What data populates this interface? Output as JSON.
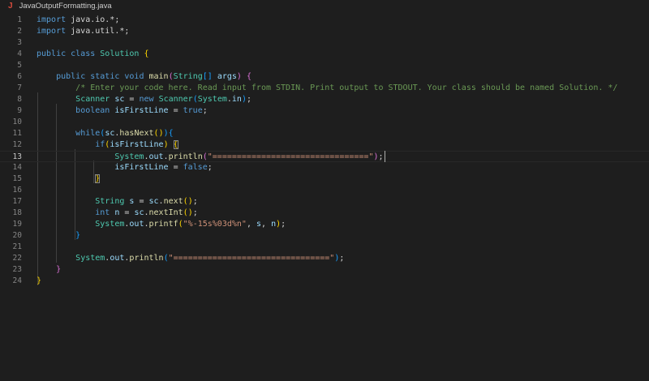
{
  "tab": {
    "icon": "java-file-icon",
    "filename": "JavaOutputFormatting.java"
  },
  "editor": {
    "active_line": 13,
    "lines": [
      {
        "n": "1",
        "tokens": [
          [
            "kw",
            "import"
          ],
          [
            "pl",
            " java.io.*;"
          ]
        ]
      },
      {
        "n": "2",
        "tokens": [
          [
            "kw",
            "import"
          ],
          [
            "pl",
            " java.util.*;"
          ]
        ]
      },
      {
        "n": "3",
        "tokens": []
      },
      {
        "n": "4",
        "tokens": [
          [
            "kw",
            "public class "
          ],
          [
            "ty",
            "Solution"
          ],
          [
            "pl",
            " "
          ],
          [
            "b1",
            "{"
          ]
        ]
      },
      {
        "n": "5",
        "tokens": []
      },
      {
        "n": "6",
        "tokens": [
          [
            "pl",
            "    "
          ],
          [
            "kw",
            "public static void "
          ],
          [
            "fn",
            "main"
          ],
          [
            "b2",
            "("
          ],
          [
            "ty",
            "String"
          ],
          [
            "b3",
            "[]"
          ],
          [
            "pl",
            " "
          ],
          [
            "vr",
            "args"
          ],
          [
            "b2",
            ")"
          ],
          [
            "pl",
            " "
          ],
          [
            "b2",
            "{"
          ]
        ]
      },
      {
        "n": "7",
        "tokens": [
          [
            "pl",
            "        "
          ],
          [
            "cm",
            "/* Enter your code here. Read input from STDIN. Print output to STDOUT. Your class should be named Solution. */"
          ]
        ]
      },
      {
        "n": "8",
        "tokens": [
          [
            "pl",
            "        "
          ],
          [
            "ty",
            "Scanner"
          ],
          [
            "pl",
            " "
          ],
          [
            "vr",
            "sc"
          ],
          [
            "pl",
            " = "
          ],
          [
            "kw",
            "new "
          ],
          [
            "ty",
            "Scanner"
          ],
          [
            "b3",
            "("
          ],
          [
            "ty",
            "System"
          ],
          [
            "pl",
            "."
          ],
          [
            "vr",
            "in"
          ],
          [
            "b3",
            ")"
          ],
          [
            "pl",
            ";"
          ]
        ]
      },
      {
        "n": "9",
        "tokens": [
          [
            "pl",
            "        "
          ],
          [
            "kw",
            "boolean "
          ],
          [
            "vr",
            "isFirstLine"
          ],
          [
            "pl",
            " = "
          ],
          [
            "kw",
            "true"
          ],
          [
            "pl",
            ";"
          ]
        ]
      },
      {
        "n": "10",
        "tokens": []
      },
      {
        "n": "11",
        "tokens": [
          [
            "pl",
            "        "
          ],
          [
            "kw",
            "while"
          ],
          [
            "b3",
            "("
          ],
          [
            "vr",
            "sc"
          ],
          [
            "pl",
            "."
          ],
          [
            "fn",
            "hasNext"
          ],
          [
            "b1",
            "()"
          ],
          [
            "b3",
            ")"
          ],
          [
            "b3",
            "{"
          ]
        ]
      },
      {
        "n": "12",
        "tokens": [
          [
            "pl",
            "            "
          ],
          [
            "kw",
            "if"
          ],
          [
            "b1",
            "("
          ],
          [
            "vr",
            "isFirstLine"
          ],
          [
            "b1",
            ")"
          ],
          [
            "pl",
            " "
          ],
          [
            "b1m",
            "{"
          ]
        ]
      },
      {
        "n": "13",
        "tokens": [
          [
            "pl",
            "                "
          ],
          [
            "ty",
            "System"
          ],
          [
            "pl",
            "."
          ],
          [
            "vr",
            "out"
          ],
          [
            "pl",
            "."
          ],
          [
            "fn",
            "println"
          ],
          [
            "b2",
            "("
          ],
          [
            "st",
            "\"================================\""
          ],
          [
            "b2",
            ")"
          ],
          [
            "pl",
            ";"
          ]
        ]
      },
      {
        "n": "14",
        "tokens": [
          [
            "pl",
            "                "
          ],
          [
            "vr",
            "isFirstLine"
          ],
          [
            "pl",
            " = "
          ],
          [
            "kw",
            "false"
          ],
          [
            "pl",
            ";"
          ]
        ]
      },
      {
        "n": "15",
        "tokens": [
          [
            "pl",
            "            "
          ],
          [
            "b1m",
            "}"
          ]
        ]
      },
      {
        "n": "16",
        "tokens": []
      },
      {
        "n": "17",
        "tokens": [
          [
            "pl",
            "            "
          ],
          [
            "ty",
            "String"
          ],
          [
            "pl",
            " "
          ],
          [
            "vr",
            "s"
          ],
          [
            "pl",
            " = "
          ],
          [
            "vr",
            "sc"
          ],
          [
            "pl",
            "."
          ],
          [
            "fn",
            "next"
          ],
          [
            "b1",
            "()"
          ],
          [
            "pl",
            ";"
          ]
        ]
      },
      {
        "n": "18",
        "tokens": [
          [
            "pl",
            "            "
          ],
          [
            "kw",
            "int "
          ],
          [
            "vr",
            "n"
          ],
          [
            "pl",
            " = "
          ],
          [
            "vr",
            "sc"
          ],
          [
            "pl",
            "."
          ],
          [
            "fn",
            "nextInt"
          ],
          [
            "b1",
            "()"
          ],
          [
            "pl",
            ";"
          ]
        ]
      },
      {
        "n": "19",
        "tokens": [
          [
            "pl",
            "            "
          ],
          [
            "ty",
            "System"
          ],
          [
            "pl",
            "."
          ],
          [
            "vr",
            "out"
          ],
          [
            "pl",
            "."
          ],
          [
            "fn",
            "printf"
          ],
          [
            "b1",
            "("
          ],
          [
            "st",
            "\"%-15s%03d%n\""
          ],
          [
            "pl",
            ", "
          ],
          [
            "vr",
            "s"
          ],
          [
            "pl",
            ", "
          ],
          [
            "vr",
            "n"
          ],
          [
            "b1",
            ")"
          ],
          [
            "pl",
            ";"
          ]
        ]
      },
      {
        "n": "20",
        "tokens": [
          [
            "pl",
            "        "
          ],
          [
            "b3",
            "}"
          ]
        ]
      },
      {
        "n": "21",
        "tokens": []
      },
      {
        "n": "22",
        "tokens": [
          [
            "pl",
            "        "
          ],
          [
            "ty",
            "System"
          ],
          [
            "pl",
            "."
          ],
          [
            "vr",
            "out"
          ],
          [
            "pl",
            "."
          ],
          [
            "fn",
            "println"
          ],
          [
            "b3",
            "("
          ],
          [
            "st",
            "\"================================\""
          ],
          [
            "b3",
            ")"
          ],
          [
            "pl",
            ";"
          ]
        ]
      },
      {
        "n": "23",
        "tokens": [
          [
            "pl",
            "    "
          ],
          [
            "b2",
            "}"
          ]
        ]
      },
      {
        "n": "24",
        "tokens": [
          [
            "b1",
            "}"
          ]
        ]
      }
    ]
  }
}
